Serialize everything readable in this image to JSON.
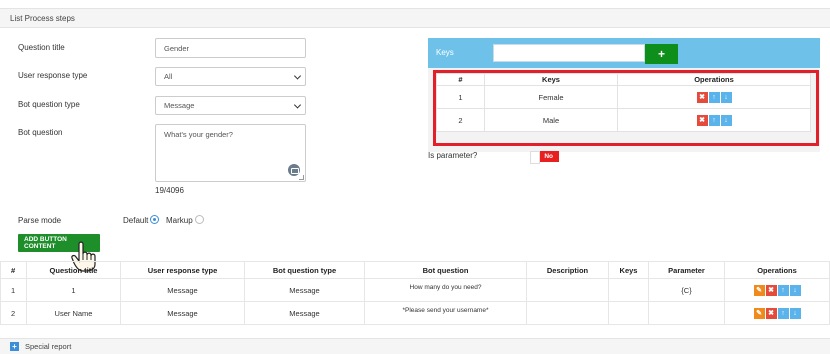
{
  "panel": {
    "title": "List Process steps"
  },
  "form": {
    "question_title_label": "Question title",
    "question_title_value": "Gender",
    "user_response_label": "User response type",
    "user_response_value": "All",
    "bot_question_type_label": "Bot question type",
    "bot_question_type_value": "Message",
    "bot_question_label": "Bot question",
    "bot_question_value": "What's your gender?",
    "char_count": "19/4096",
    "parse_mode_label": "Parse mode",
    "parse_default_label": "Default",
    "parse_markup_label": "Markup",
    "parse_mode_selected": "Default",
    "add_button_label": "ADD BUTTON CONTENT"
  },
  "keys": {
    "title": "Keys",
    "input_value": "",
    "add_label": "+",
    "columns": [
      "#",
      "Keys",
      "Operations"
    ],
    "rows": [
      {
        "num": "1",
        "key": "Female"
      },
      {
        "num": "2",
        "key": "Male"
      }
    ],
    "is_parameter_label": "Is parameter?",
    "toggle_label": "No"
  },
  "steps": {
    "columns": [
      "#",
      "Question title",
      "User response type",
      "Bot question type",
      "Bot question",
      "Description",
      "Keys",
      "Parameter",
      "Operations"
    ],
    "rows": [
      {
        "num": "1",
        "title": "1",
        "response": "Message",
        "bot_type": "Message",
        "question": "How many do you need?",
        "description": "",
        "keys": "",
        "parameter": "{C}"
      },
      {
        "num": "2",
        "title": "User Name",
        "response": "Message",
        "bot_type": "Message",
        "question": "*Please send your username*",
        "description": "",
        "keys": "",
        "parameter": ""
      }
    ]
  },
  "footer": {
    "title": "Special report"
  },
  "icons": {
    "delete": "times-icon",
    "up": "arrow-up-icon",
    "down": "arrow-down-icon",
    "edit": "pencil-icon",
    "plus": "plus-icon"
  },
  "colors": {
    "accent_green": "#1e8e2a",
    "keys_header": "#6ec2ea",
    "highlight_red": "#e3202a",
    "delete_red": "#e64a3a",
    "move_blue": "#5ab3ea",
    "edit_orange": "#f08a1c"
  }
}
